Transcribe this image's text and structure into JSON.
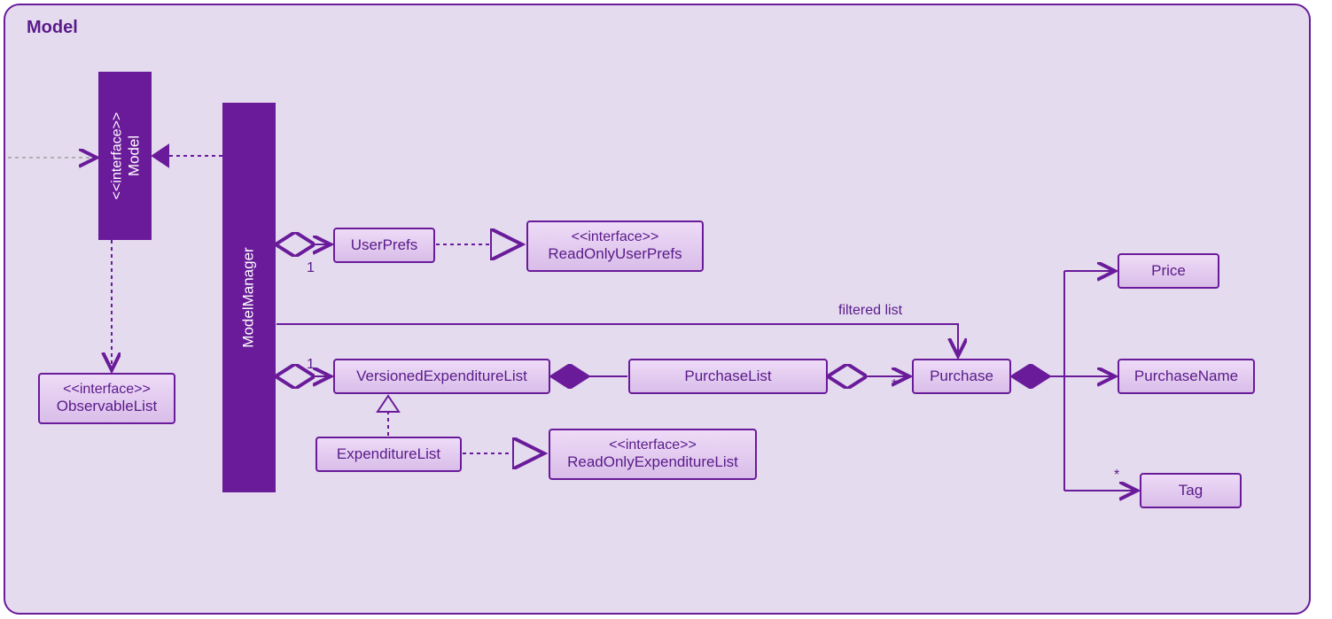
{
  "package": {
    "title": "Model"
  },
  "model_interface": {
    "stereotype": "<<interface>>",
    "name": "Model"
  },
  "model_manager": {
    "name": "ModelManager"
  },
  "observable_list": {
    "stereotype": "<<interface>>",
    "name": "ObservableList"
  },
  "user_prefs": {
    "name": "UserPrefs"
  },
  "readonly_userprefs": {
    "stereotype": "<<interface>>",
    "name": "ReadOnlyUserPrefs"
  },
  "versioned_exp_list": {
    "name": "VersionedExpenditureList"
  },
  "purchase_list": {
    "name": "PurchaseList"
  },
  "purchase": {
    "name": "Purchase"
  },
  "expenditure_list": {
    "name": "ExpenditureList"
  },
  "readonly_exp_list": {
    "stereotype": "<<interface>>",
    "name": "ReadOnlyExpenditureList"
  },
  "price": {
    "name": "Price"
  },
  "purchase_name": {
    "name": "PurchaseName"
  },
  "tag": {
    "name": "Tag"
  },
  "labels": {
    "filtered_list": "filtered list",
    "one_a": "1",
    "one_b": "1",
    "star_a": "*",
    "star_b": "*"
  }
}
